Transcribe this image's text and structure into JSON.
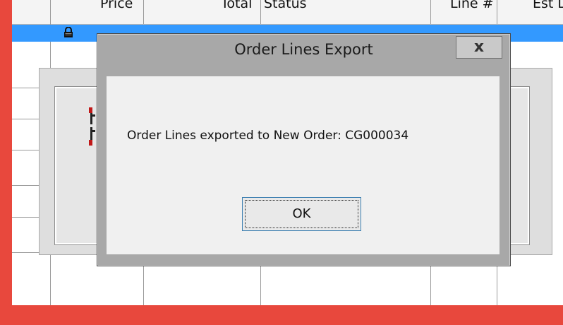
{
  "table": {
    "headers": [
      "Price",
      "Total",
      "Status",
      "Line #",
      "Est L"
    ]
  },
  "dialog": {
    "title": "Order Lines Export",
    "close_label": "x",
    "message": "Order Lines exported to New Order: CG000034",
    "ok_label": "OK"
  },
  "colors": {
    "frame": "#e8483d",
    "selection": "#3399ff",
    "dialog_frame": "#a8a8a8",
    "dialog_client": "#f0f0f0"
  },
  "icons": {
    "row_lock": "lock-icon"
  }
}
